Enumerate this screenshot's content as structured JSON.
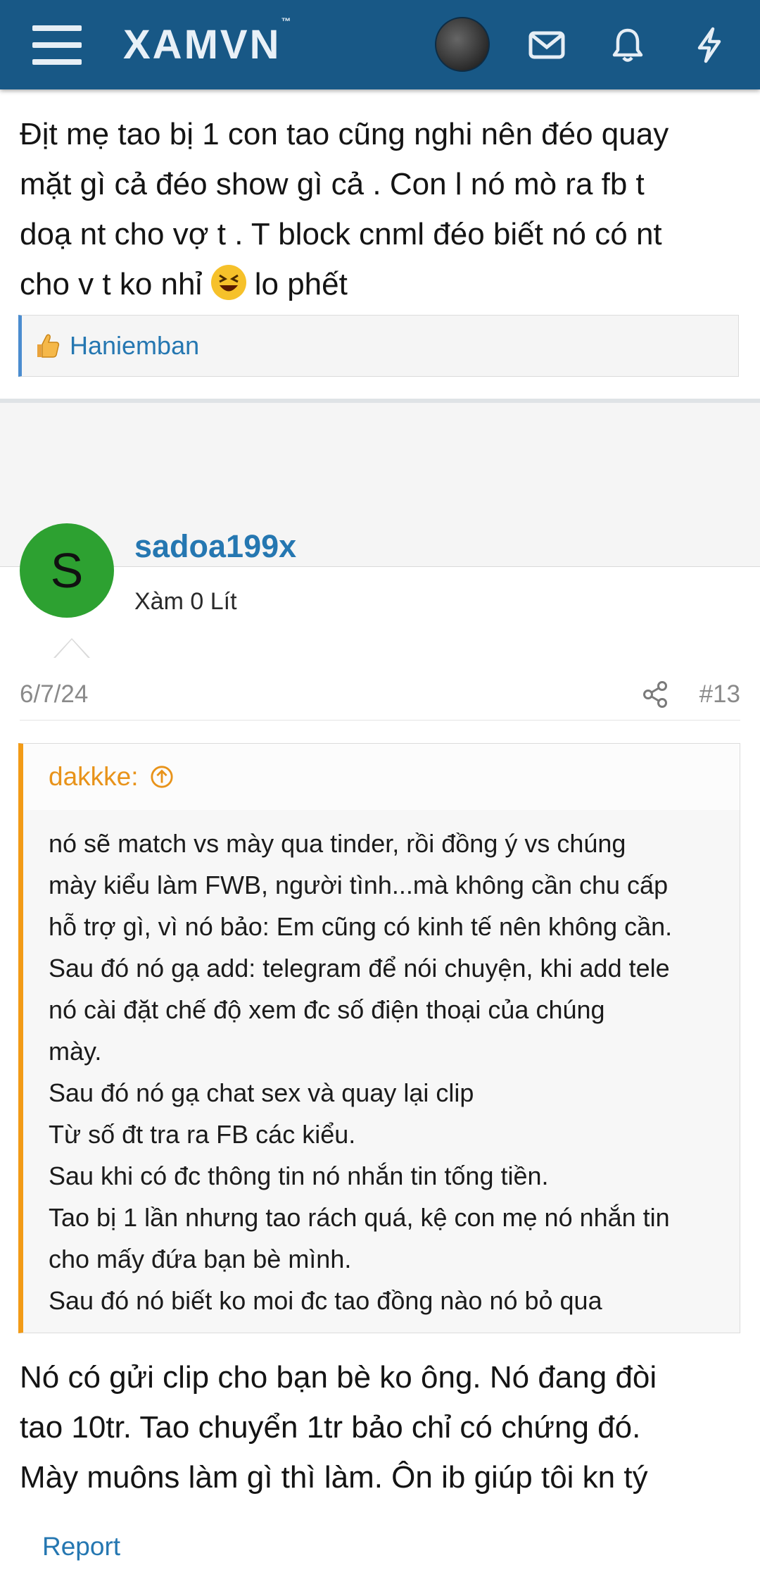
{
  "header": {
    "logo": "XAMVN",
    "logo_tm": "™",
    "icons": [
      "menu-icon",
      "avatar",
      "mail-icon",
      "bell-icon",
      "lightning-icon"
    ],
    "brand_color": "#185886"
  },
  "post1": {
    "text_lines": [
      "Địt mẹ tao bị 1 con tao cũng nghi nên đéo quay",
      "mặt gì cả đéo show gì cả . Con l nó mò ra fb t",
      "doạ nt cho vợ t . T block cnml đéo biết nó có nt",
      "cho v t ko nhỉ",
      "lo phết"
    ],
    "report_label": "Report",
    "likes_name": "Haniemban"
  },
  "post2": {
    "avatar_letter": "S",
    "avatar_color": "#2da131",
    "username": "sadoa199x",
    "user_title": "Xàm 0 Lít",
    "date": "6/7/24",
    "post_number": "#13",
    "quote": {
      "author": "dakkke:",
      "lines": [
        "nó sẽ match vs mày qua tinder, rồi đồng ý vs chúng",
        "mày kiểu làm FWB, người tình...mà không cần chu cấp",
        "hỗ trợ gì, vì nó bảo: Em cũng có kinh tế nên không cần.",
        "Sau đó nó gạ add: telegram để nói chuyện, khi add tele",
        "nó cài đặt chế độ xem đc số điện thoại của chúng",
        "mày.",
        "Sau đó nó gạ chat sex và quay lại clip",
        "Từ số đt tra ra FB các kiểu.",
        "Sau khi có đc thông tin nó nhắn tin tống tiền.",
        "Tao bị 1 lần nhưng tao rách quá, kệ con mẹ nó nhắn tin",
        "cho mấy đứa bạn bè mình.",
        "Sau đó nó biết ko moi đc tao đồng nào nó bỏ qua"
      ]
    },
    "text_lines": [
      "Nó có gửi clip cho bạn bè ko ông. Nó đang đòi",
      "tao 10tr. Tao chuyển 1tr bảo chỉ có chứng đó.",
      "Mày muôns làm gì thì làm. Ôn ib giúp tôi kn tý"
    ],
    "report_label": "Report"
  }
}
